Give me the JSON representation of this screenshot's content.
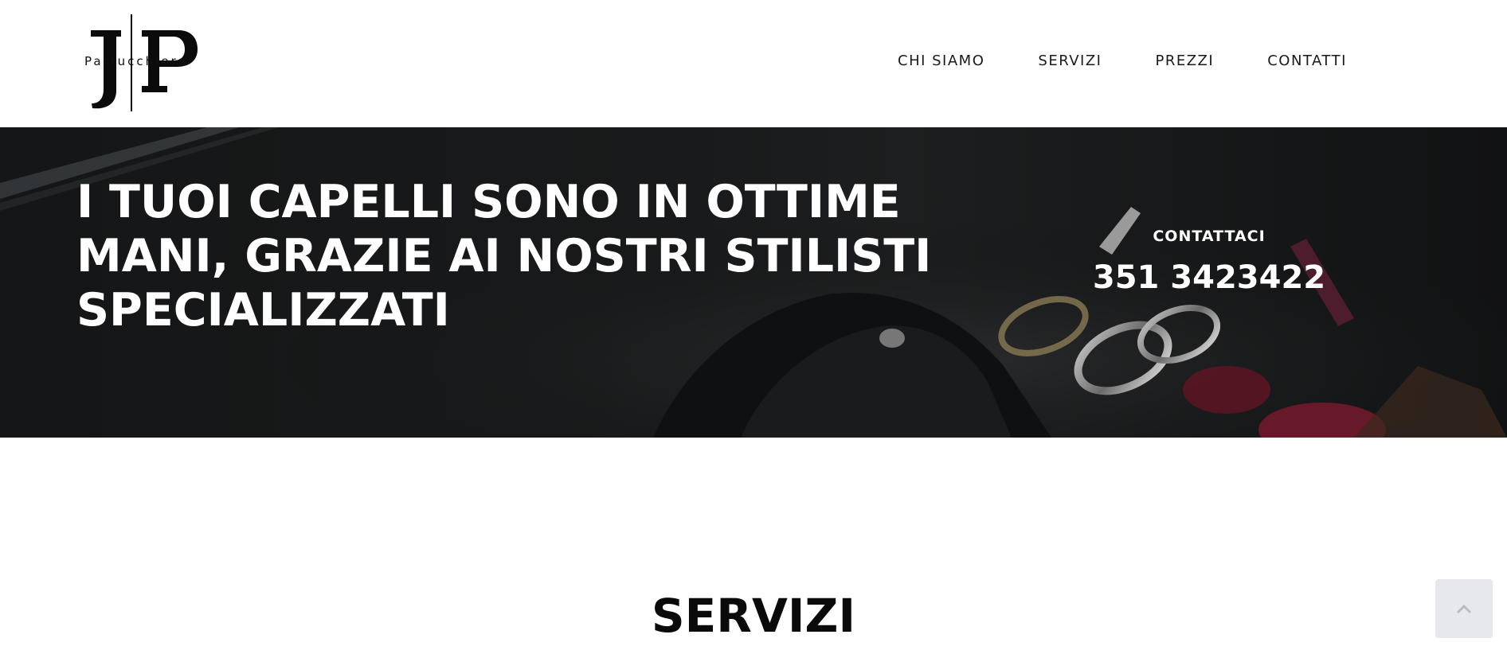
{
  "header": {
    "logo_text": "Parrucchiera",
    "logo_monogram": "JP",
    "nav": [
      {
        "label": "CHI SIAMO"
      },
      {
        "label": "SERVIZI"
      },
      {
        "label": "PREZZI"
      },
      {
        "label": "CONTATTI"
      }
    ]
  },
  "hero": {
    "title": "I TUOI CAPELLI SONO IN OTTIME MANI, GRAZIE AI NOSTRI STILISTI SPECIALIZZATI",
    "contact_label": "CONTATTACI",
    "contact_phone": "351 3423422"
  },
  "section": {
    "title": "SERVIZI"
  },
  "icons": {
    "scroll_top": "chevron-up-icon"
  },
  "colors": {
    "hero_bg": "#161819",
    "text_dark": "#0a0a0a",
    "scroll_top_bg": "#e6e8eb"
  }
}
